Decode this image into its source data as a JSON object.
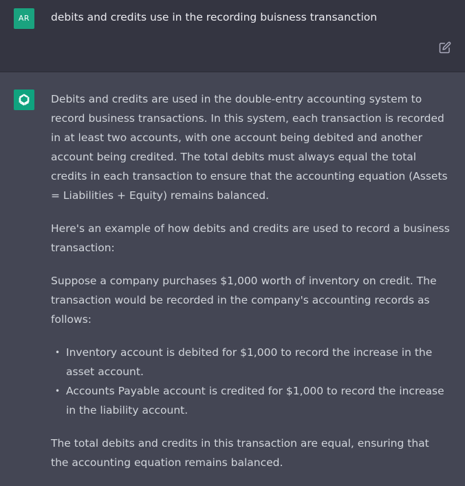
{
  "user": {
    "avatar_initials": "AR",
    "message": "debits and credits use in the recording buisness transanction"
  },
  "assistant": {
    "paragraphs": [
      "Debits and credits are used in the double-entry accounting system to record business transactions. In this system, each transaction is recorded in at least two accounts, with one account being debited and another account being credited. The total debits must always equal the total credits in each transaction to ensure that the accounting equation (Assets = Liabilities + Equity) remains balanced.",
      "Here's an example of how debits and credits are used to record a business transaction:",
      "Suppose a company purchases $1,000 worth of inventory on credit. The transaction would be recorded in the company's accounting records as follows:"
    ],
    "bullets": [
      "Inventory account is debited for $1,000 to record the increase in the asset account.",
      "Accounts Payable account is credited for $1,000 to record the increase in the liability account."
    ],
    "closing": "The total debits and credits in this transaction are equal, ensuring that the accounting equation remains balanced."
  },
  "colors": {
    "user_bg": "#343541",
    "assistant_bg": "#444654",
    "avatar_user": "#1aa37f",
    "avatar_bot": "#10a37f",
    "text": "#d1d5db"
  },
  "icons": {
    "edit": "edit-icon",
    "bot": "openai-logo-icon"
  }
}
